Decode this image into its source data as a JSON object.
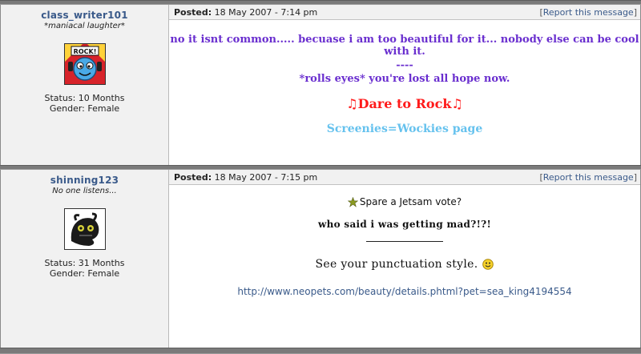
{
  "posts": [
    {
      "username": "class_writer101",
      "user_title": "*maniacal laughter*",
      "status": "Status: 10 Months",
      "gender": "Gender: Female",
      "posted_label": "Posted:",
      "posted_date": "18 May 2007 - 7:14 pm",
      "report_open": "[",
      "report_link": "Report this message",
      "report_close": "]",
      "avatar_icon": "rock-avatar-icon",
      "avatar_text": "ROCK!",
      "lines": [
        "no it isnt common..... becuase i am too beautiful for it... nobody else can be cool with it.",
        "----",
        "*rolls eyes* you're lost all hope now."
      ],
      "signature_note_left": "♫",
      "signature_text": "Dare to Rock",
      "signature_note_right": "♫",
      "signature_link": "Screenies=Wockies page",
      "colors": {
        "purple": "#6a2fcf",
        "red": "#ff1a1a",
        "blue": "#66c2ee"
      }
    },
    {
      "username": "shinning123",
      "user_title": "No one listens...",
      "status": "Status: 31 Months",
      "gender": "Gender: Female",
      "posted_label": "Posted:",
      "posted_date": "18 May 2007 - 7:15 pm",
      "report_open": "[",
      "report_link": "Report this message",
      "report_close": "]",
      "avatar_icon": "jetsam-avatar-icon",
      "vote_text": "Spare a Jetsam vote?",
      "star_icon": "star-icon",
      "mad_text": "who said i was getting mad?!?!",
      "punct_text": "See your punctuation style.",
      "smiley_icon": "smiley-icon",
      "url": "http://www.neopets.com/beauty/details.phtml?pet=sea_king4194554"
    }
  ]
}
